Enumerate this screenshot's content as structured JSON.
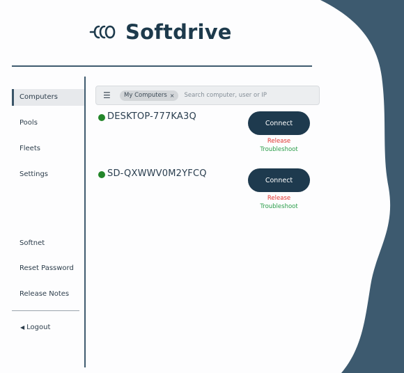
{
  "brand": {
    "name": "Softdrive",
    "logo_icon": "softdrive-logo-icon"
  },
  "colors": {
    "background": "#3d5a6f",
    "panel": "#fdfdfe",
    "accent": "#1e3a4e",
    "online": "#23862a",
    "release": "#e0332f",
    "troubleshoot": "#2a9d49"
  },
  "sidebar": {
    "items": [
      {
        "label": "Computers",
        "active": true
      },
      {
        "label": "Pools",
        "active": false
      },
      {
        "label": "Fleets",
        "active": false
      },
      {
        "label": "Settings",
        "active": false
      },
      {
        "label": "Softnet",
        "active": false
      },
      {
        "label": "Reset Password",
        "active": false
      },
      {
        "label": "Release Notes",
        "active": false
      }
    ],
    "logout_label": "Logout"
  },
  "search": {
    "filter_chip": "My Computers",
    "placeholder": "Search computer, user or IP"
  },
  "computers": [
    {
      "name": "DESKTOP-777KA3Q",
      "status": "online",
      "connect_label": "Connect",
      "release_label": "Release",
      "troubleshoot_label": "Troubleshoot"
    },
    {
      "name": "SD-QXWWV0M2YFCQ",
      "status": "online",
      "connect_label": "Connect",
      "release_label": "Release",
      "troubleshoot_label": "Troubleshoot"
    }
  ]
}
